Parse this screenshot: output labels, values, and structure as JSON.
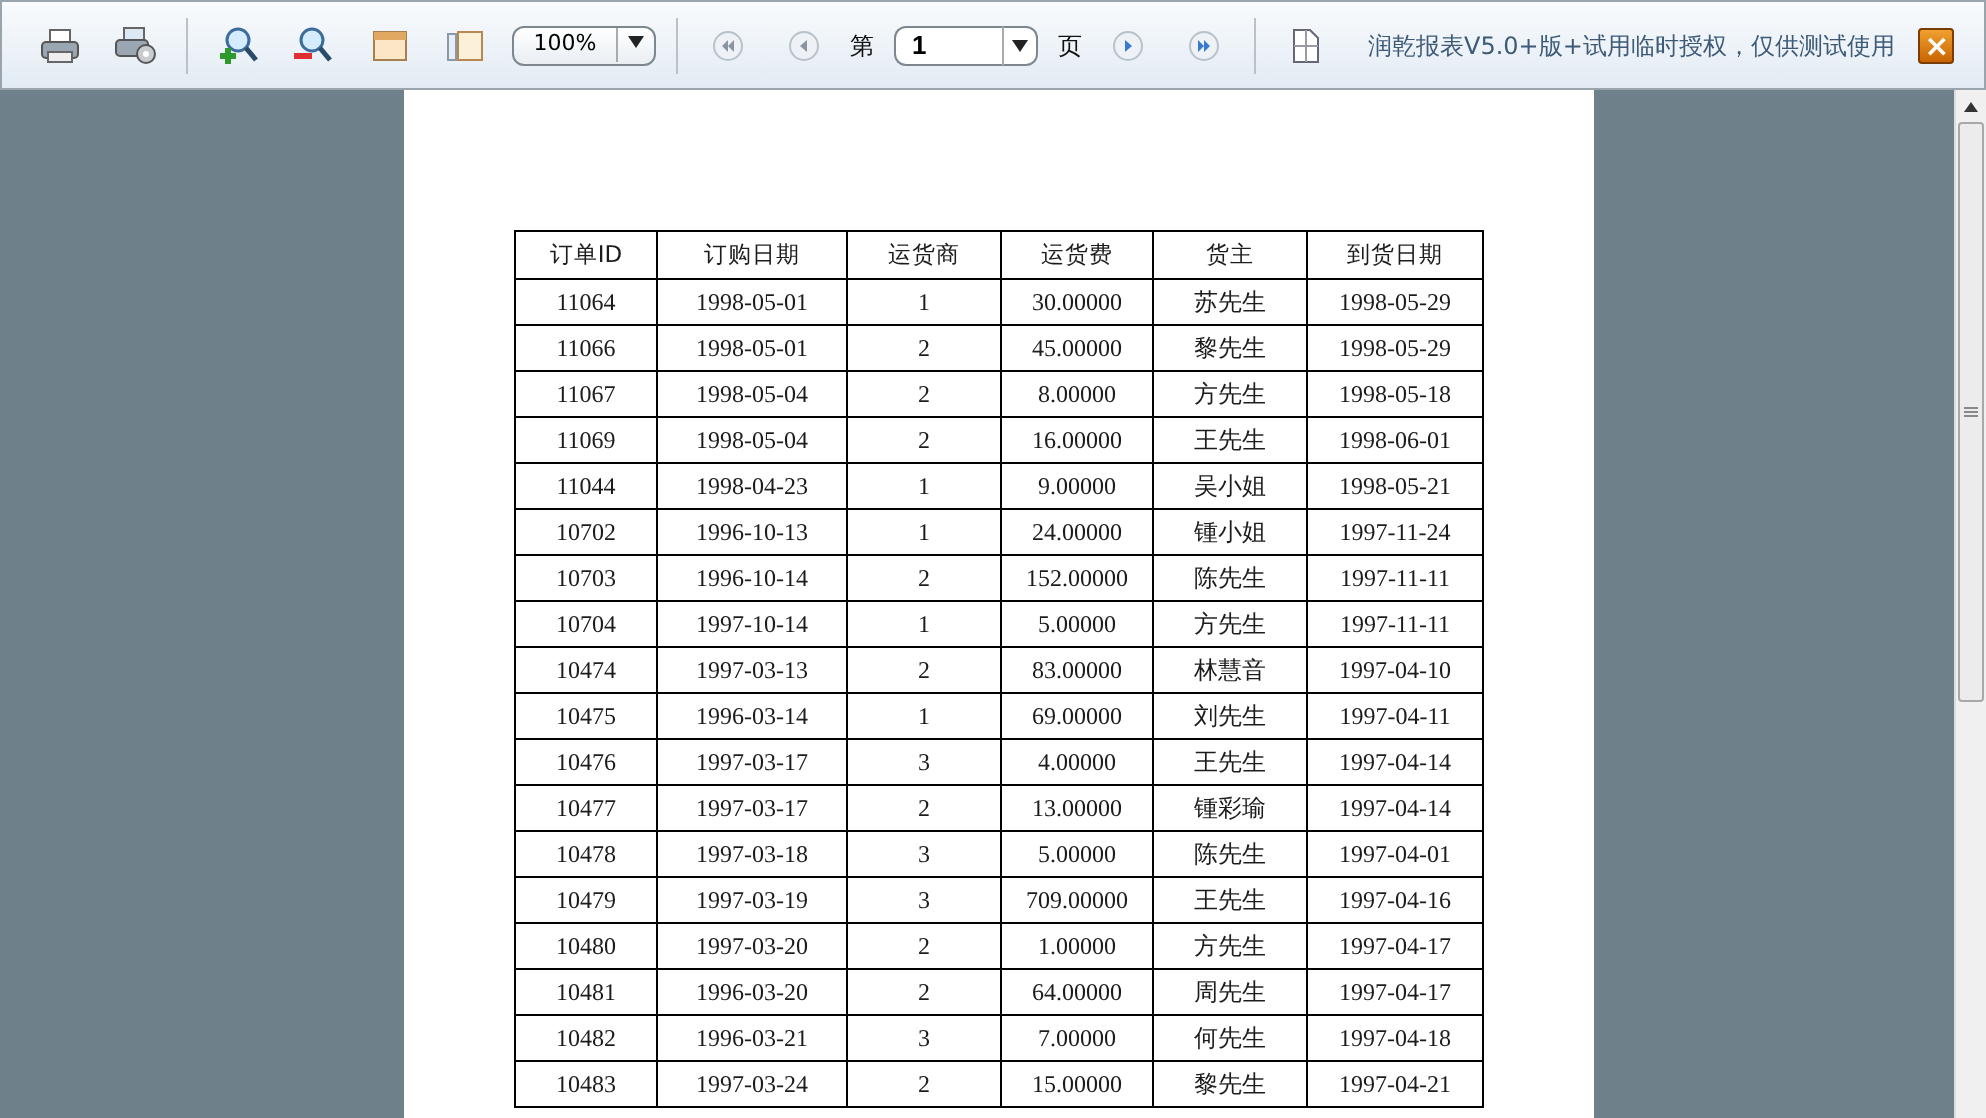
{
  "toolbar": {
    "zoom": "100%",
    "page_prefix": "第",
    "page_value": "1",
    "page_suffix": "页",
    "notice": "润乾报表V5.0+版+试用临时授权，仅供测试使用",
    "close": "×"
  },
  "table": {
    "columns": [
      "订单ID",
      "订购日期",
      "运货商",
      "运货费",
      "货主",
      "到货日期"
    ],
    "rows": [
      [
        "11064",
        "1998-05-01",
        "1",
        "30.00000",
        "苏先生",
        "1998-05-29"
      ],
      [
        "11066",
        "1998-05-01",
        "2",
        "45.00000",
        "黎先生",
        "1998-05-29"
      ],
      [
        "11067",
        "1998-05-04",
        "2",
        "8.00000",
        "方先生",
        "1998-05-18"
      ],
      [
        "11069",
        "1998-05-04",
        "2",
        "16.00000",
        "王先生",
        "1998-06-01"
      ],
      [
        "11044",
        "1998-04-23",
        "1",
        "9.00000",
        "吴小姐",
        "1998-05-21"
      ],
      [
        "10702",
        "1996-10-13",
        "1",
        "24.00000",
        "锺小姐",
        "1997-11-24"
      ],
      [
        "10703",
        "1996-10-14",
        "2",
        "152.00000",
        "陈先生",
        "1997-11-11"
      ],
      [
        "10704",
        "1997-10-14",
        "1",
        "5.00000",
        "方先生",
        "1997-11-11"
      ],
      [
        "10474",
        "1997-03-13",
        "2",
        "83.00000",
        "林慧音",
        "1997-04-10"
      ],
      [
        "10475",
        "1996-03-14",
        "1",
        "69.00000",
        "刘先生",
        "1997-04-11"
      ],
      [
        "10476",
        "1997-03-17",
        "3",
        "4.00000",
        "王先生",
        "1997-04-14"
      ],
      [
        "10477",
        "1997-03-17",
        "2",
        "13.00000",
        "锺彩瑜",
        "1997-04-14"
      ],
      [
        "10478",
        "1997-03-18",
        "3",
        "5.00000",
        "陈先生",
        "1997-04-01"
      ],
      [
        "10479",
        "1997-03-19",
        "3",
        "709.00000",
        "王先生",
        "1997-04-16"
      ],
      [
        "10480",
        "1997-03-20",
        "2",
        "1.00000",
        "方先生",
        "1997-04-17"
      ],
      [
        "10481",
        "1996-03-20",
        "2",
        "64.00000",
        "周先生",
        "1997-04-17"
      ],
      [
        "10482",
        "1996-03-21",
        "3",
        "7.00000",
        "何先生",
        "1997-04-18"
      ],
      [
        "10483",
        "1997-03-24",
        "2",
        "15.00000",
        "黎先生",
        "1997-04-21"
      ]
    ]
  }
}
